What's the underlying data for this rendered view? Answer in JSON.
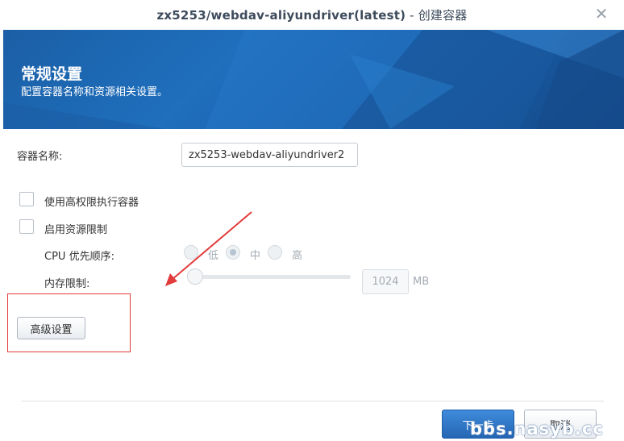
{
  "window": {
    "title_main": "zx5253/webdav-aliyundriver(latest)",
    "title_separator": " - ",
    "title_action": "创建容器"
  },
  "banner": {
    "heading": "常规设置",
    "subtitle": "配置容器名称和资源相关设置。"
  },
  "form": {
    "container_name_label": "容器名称:",
    "container_name_value": "zx5253-webdav-aliyundriver2",
    "privileged_label": "使用高权限执行容器",
    "resource_limit_label": "启用资源限制",
    "cpu_priority_label": "CPU 优先顺序:",
    "cpu_options": [
      "低",
      "中",
      "高"
    ],
    "cpu_selected": "中",
    "memory_label": "内存限制:",
    "memory_value": "1024",
    "memory_unit": "MB",
    "advanced_button": "高级设置"
  },
  "footer": {
    "next_button": "下一步",
    "cancel_button": "取消"
  },
  "watermark": "bbs.nasyb.cc",
  "colors": {
    "banner": "#1f6fbd",
    "primary_button": "#2f78c8",
    "annotation_red": "#e23b3b"
  }
}
